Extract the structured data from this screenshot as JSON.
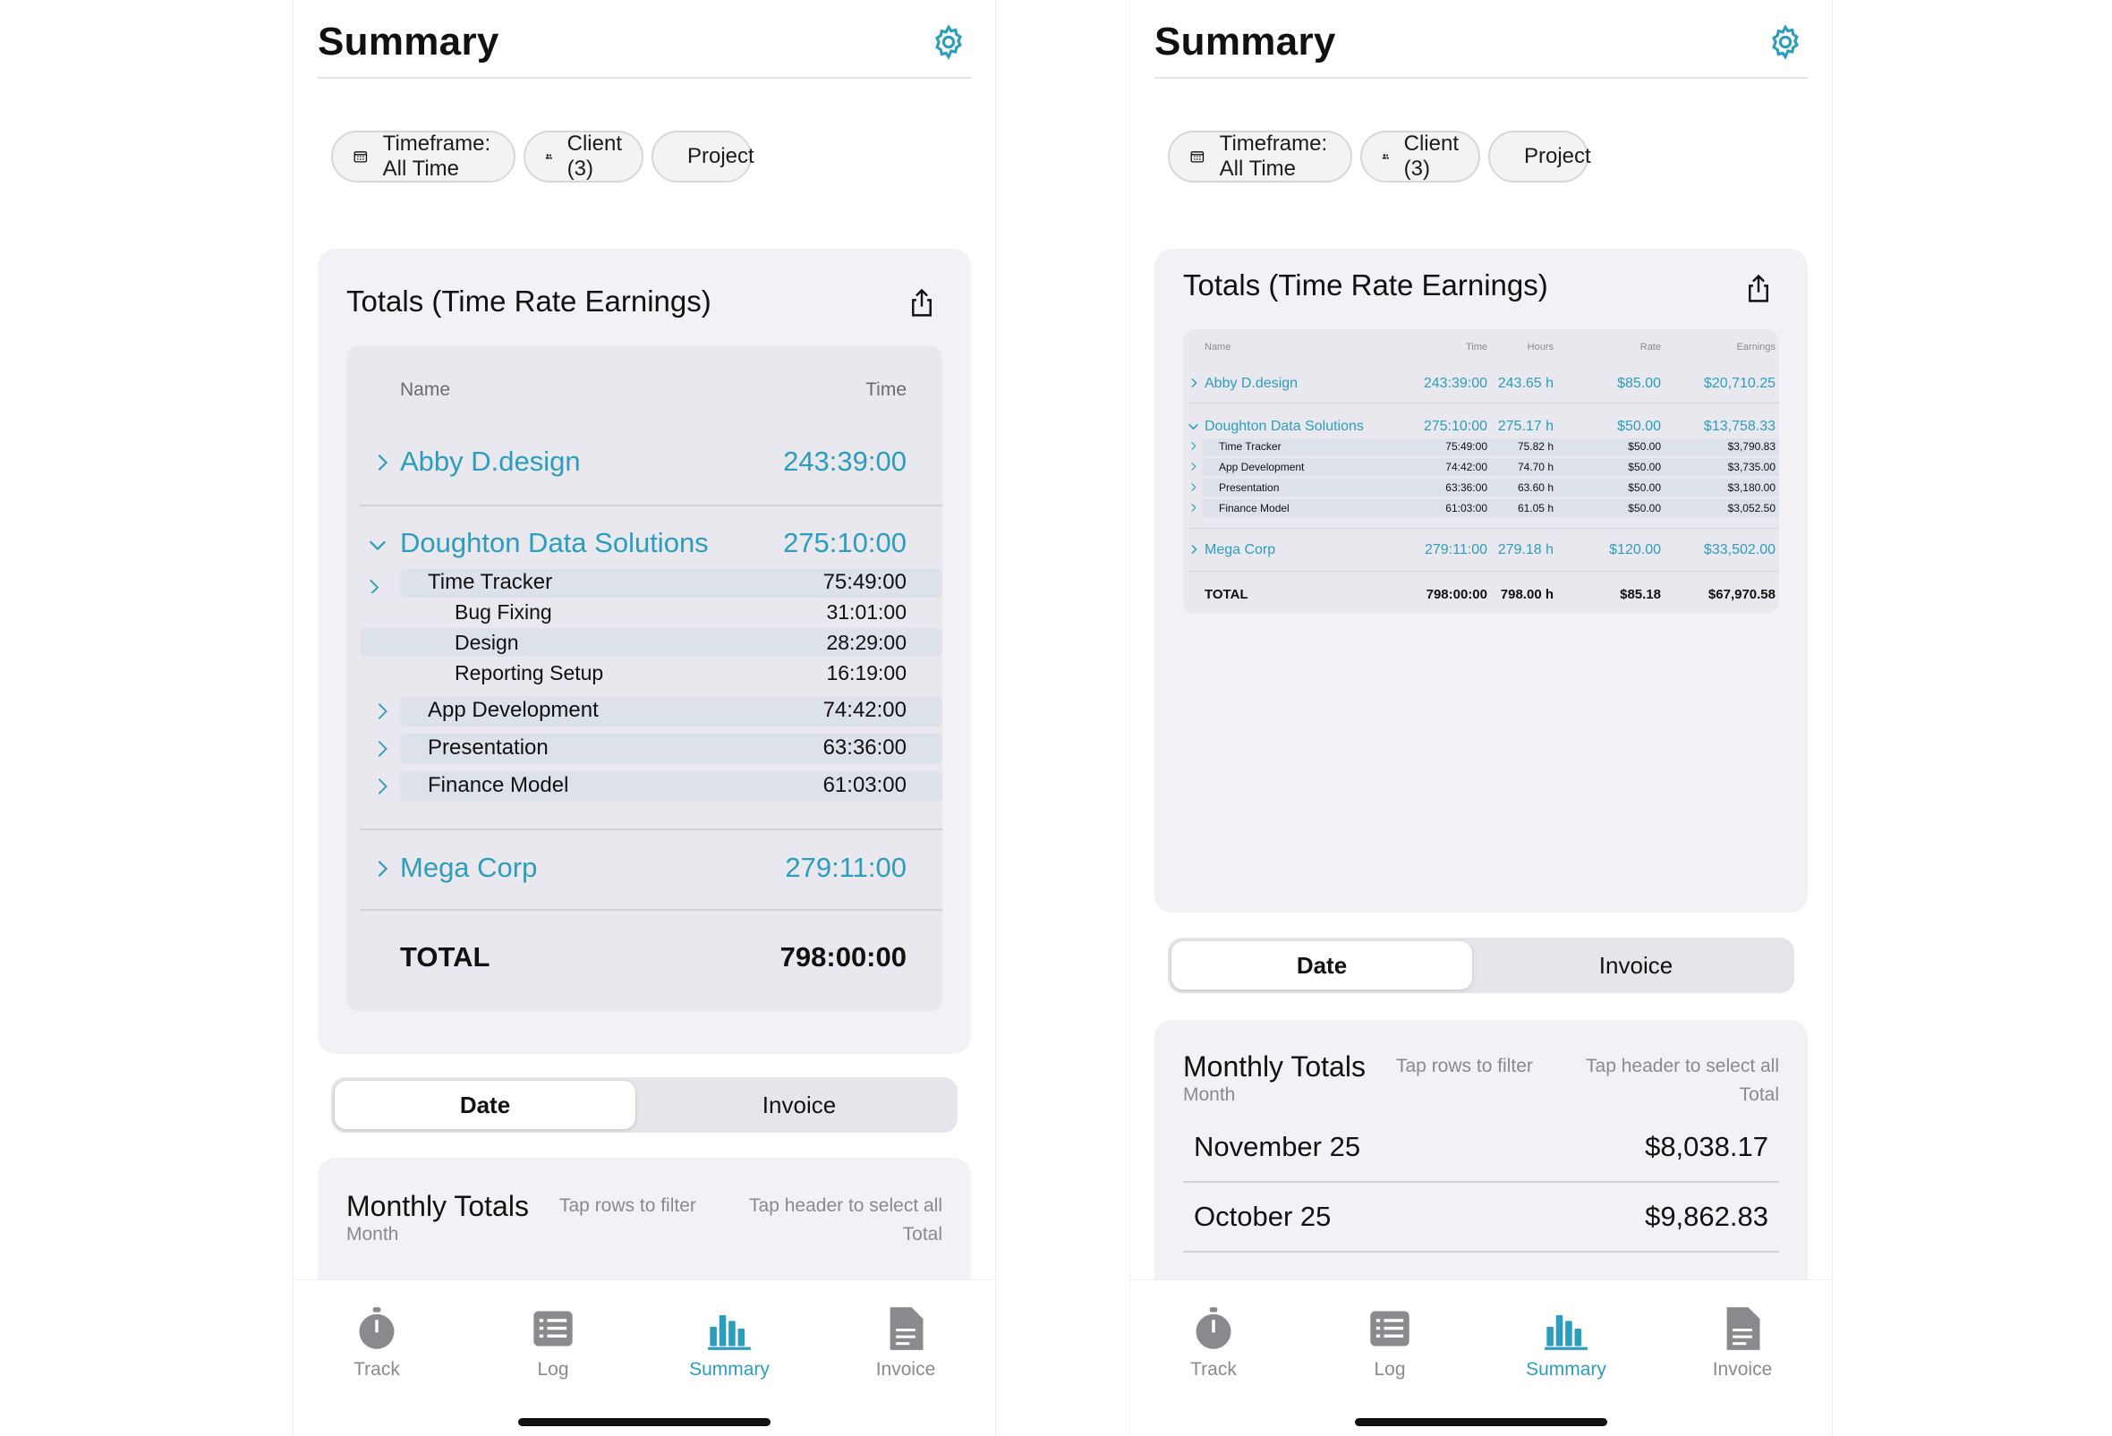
{
  "screens": {
    "header_title": "Summary",
    "filters": {
      "timeframe": "Timeframe: All Time",
      "client": "Client (3)",
      "project": "Project"
    },
    "totals_title": "Totals (Time  Rate  Earnings)",
    "segment": {
      "date": "Date",
      "invoice": "Invoice"
    },
    "monthly": {
      "title": "Monthly Totals",
      "hint_filter": "Tap rows to filter",
      "hint_select": "Tap header to select all",
      "col_month": "Month",
      "col_total": "Total",
      "rows": [
        {
          "month": "November 25",
          "total": "$8,038.17"
        },
        {
          "month": "October 25",
          "total": "$9,862.83"
        }
      ]
    },
    "tabs": [
      {
        "label": "Track",
        "icon": "stopwatch-icon"
      },
      {
        "label": "Log",
        "icon": "list-icon"
      },
      {
        "label": "Summary",
        "icon": "bar-chart-icon"
      },
      {
        "label": "Invoice",
        "icon": "document-icon"
      }
    ]
  },
  "left_table": {
    "col_name": "Name",
    "col_time": "Time",
    "clients": [
      {
        "name": "Abby D.design",
        "time": "243:39:00"
      },
      {
        "name": "Doughton Data Solutions",
        "time": "275:10:00"
      },
      {
        "name": "Mega Corp",
        "time": "279:11:00"
      }
    ],
    "projects": [
      {
        "name": "Time Tracker",
        "time": "75:49:00"
      },
      {
        "name": "App Development",
        "time": "74:42:00"
      },
      {
        "name": "Presentation",
        "time": "63:36:00"
      },
      {
        "name": "Finance Model",
        "time": "61:03:00"
      }
    ],
    "tasks": [
      {
        "name": "Bug Fixing",
        "time": "31:01:00"
      },
      {
        "name": "Design",
        "time": "28:29:00"
      },
      {
        "name": "Reporting Setup",
        "time": "16:19:00"
      }
    ],
    "total_label": "TOTAL",
    "total_time": "798:00:00"
  },
  "right_table": {
    "headers": {
      "name": "Name",
      "time": "Time",
      "hours": "Hours",
      "rate": "Rate",
      "earnings": "Earnings"
    },
    "clients": [
      {
        "name": "Abby D.design",
        "time": "243:39:00",
        "hours": "243.65 h",
        "rate": "$85.00",
        "earnings": "$20,710.25"
      },
      {
        "name": "Doughton Data Solutions",
        "time": "275:10:00",
        "hours": "275.17 h",
        "rate": "$50.00",
        "earnings": "$13,758.33"
      },
      {
        "name": "Mega Corp",
        "time": "279:11:00",
        "hours": "279.18 h",
        "rate": "$120.00",
        "earnings": "$33,502.00"
      }
    ],
    "projects": [
      {
        "name": "Time Tracker",
        "time": "75:49:00",
        "hours": "75.82 h",
        "rate": "$50.00",
        "earnings": "$3,790.83"
      },
      {
        "name": "App Development",
        "time": "74:42:00",
        "hours": "74.70 h",
        "rate": "$50.00",
        "earnings": "$3,735.00"
      },
      {
        "name": "Presentation",
        "time": "63:36:00",
        "hours": "63.60 h",
        "rate": "$50.00",
        "earnings": "$3,180.00"
      },
      {
        "name": "Finance Model",
        "time": "61:03:00",
        "hours": "61.05 h",
        "rate": "$50.00",
        "earnings": "$3,052.50"
      }
    ],
    "total": {
      "name": "TOTAL",
      "time": "798:00:00",
      "hours": "798.00 h",
      "rate": "$85.18",
      "earnings": "$67,970.58"
    }
  },
  "colors": {
    "accent": "#2c9dbd",
    "card": "#f2f2f6",
    "inner": "#e8e8ee"
  }
}
